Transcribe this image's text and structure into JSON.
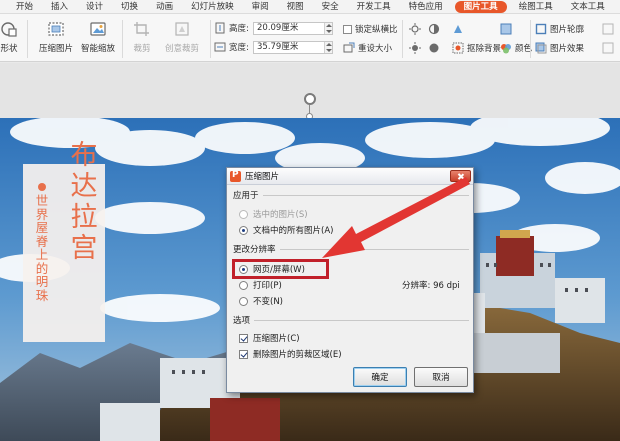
{
  "menu": {
    "items": [
      "开始",
      "插入",
      "设计",
      "切换",
      "动画",
      "幻灯片放映",
      "审阅",
      "视图",
      "安全",
      "开发工具",
      "特色应用",
      "图片工具",
      "绘图工具",
      "文本工具"
    ],
    "active_index": 11
  },
  "toolbar": {
    "shape_label": "形状",
    "compress_label": "压缩图片",
    "smart_zoom_label": "智能缩放",
    "crop_label": "裁剪",
    "create_crop_label": "创意裁剪",
    "height_label": "高度:",
    "height_value": "20.09厘米",
    "width_label": "宽度:",
    "width_value": "35.79厘米",
    "lock_ratio_label": "锁定纵横比",
    "reset_size_label": "重设大小",
    "matting_label": "抠除背景",
    "color_label": "颜色",
    "outline_label": "图片轮廓",
    "effect_label": "图片效果"
  },
  "slide": {
    "title": "布达拉宫",
    "subtitle": "世界屋脊上的明珠"
  },
  "dialog": {
    "title": "压缩图片",
    "apply_to_label": "应用于",
    "apply_selected": "选中的图片(S)",
    "apply_all": "文档中的所有图片(A)",
    "resolution_group": "更改分辨率",
    "opt_web": "网页/屏幕(W)",
    "opt_print": "打印(P)",
    "opt_unchanged": "不变(N)",
    "resolution_text": "分辨率: 96 dpi",
    "options_group": "选项",
    "compress_images": "压缩图片(C)",
    "delete_crop": "删除图片的剪裁区域(E)",
    "ok_label": "确定",
    "cancel_label": "取消"
  },
  "colors": {
    "accent": "#e8572a",
    "title_text": "#e8704b",
    "highlight": "#c1202a",
    "arrow": "#e23632"
  }
}
